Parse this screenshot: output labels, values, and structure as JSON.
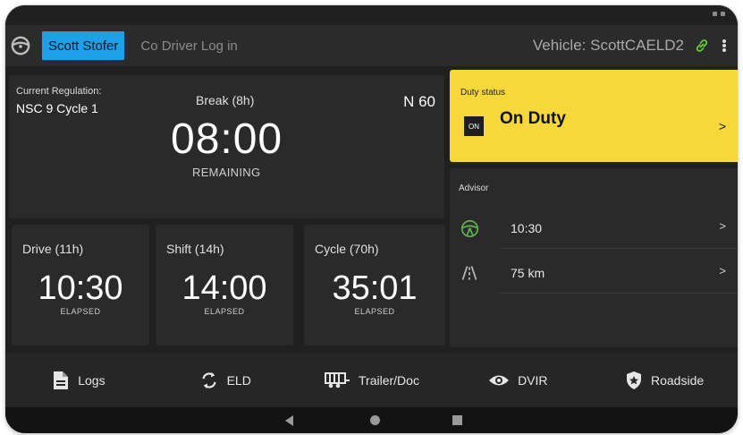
{
  "topbar": {
    "driver_name": "Scott Stofer",
    "co_driver_label": "Co Driver Log in",
    "vehicle_label": "Vehicle: ScottCAELD2"
  },
  "regulation": {
    "label": "Current Regulation:",
    "value": "NSC 9 Cycle 1"
  },
  "break": {
    "label": "Break (8h)",
    "time": "08:00",
    "status": "REMAINING"
  },
  "latitude_indicator": "N 60",
  "timers": [
    {
      "label": "Drive (11h)",
      "time": "10:30",
      "status": "ELAPSED"
    },
    {
      "label": "Shift (14h)",
      "time": "14:00",
      "status": "ELAPSED"
    },
    {
      "label": "Cycle (70h)",
      "time": "35:01",
      "status": "ELAPSED"
    }
  ],
  "duty_status": {
    "label": "Duty status",
    "badge": "ON",
    "value": "On Duty",
    "chevron": ">"
  },
  "advisor": {
    "label": "Advisor",
    "rows": [
      {
        "icon": "steering-wheel-icon",
        "value": "10:30",
        "chevron": ">"
      },
      {
        "icon": "road-icon",
        "value": "75 km",
        "chevron": ">"
      }
    ]
  },
  "bottom_nav": [
    {
      "label": "Logs",
      "icon": "document-icon"
    },
    {
      "label": "ELD",
      "icon": "sync-icon"
    },
    {
      "label": "Trailer/Doc",
      "icon": "trailer-icon"
    },
    {
      "label": "DVIR",
      "icon": "eye-icon"
    },
    {
      "label": "Roadside",
      "icon": "shield-star-icon"
    }
  ],
  "colors": {
    "accent_blue": "#1ea0e8",
    "duty_yellow": "#f6d83a",
    "link_green": "#66cc33",
    "advisor_green": "#5fb04a"
  }
}
